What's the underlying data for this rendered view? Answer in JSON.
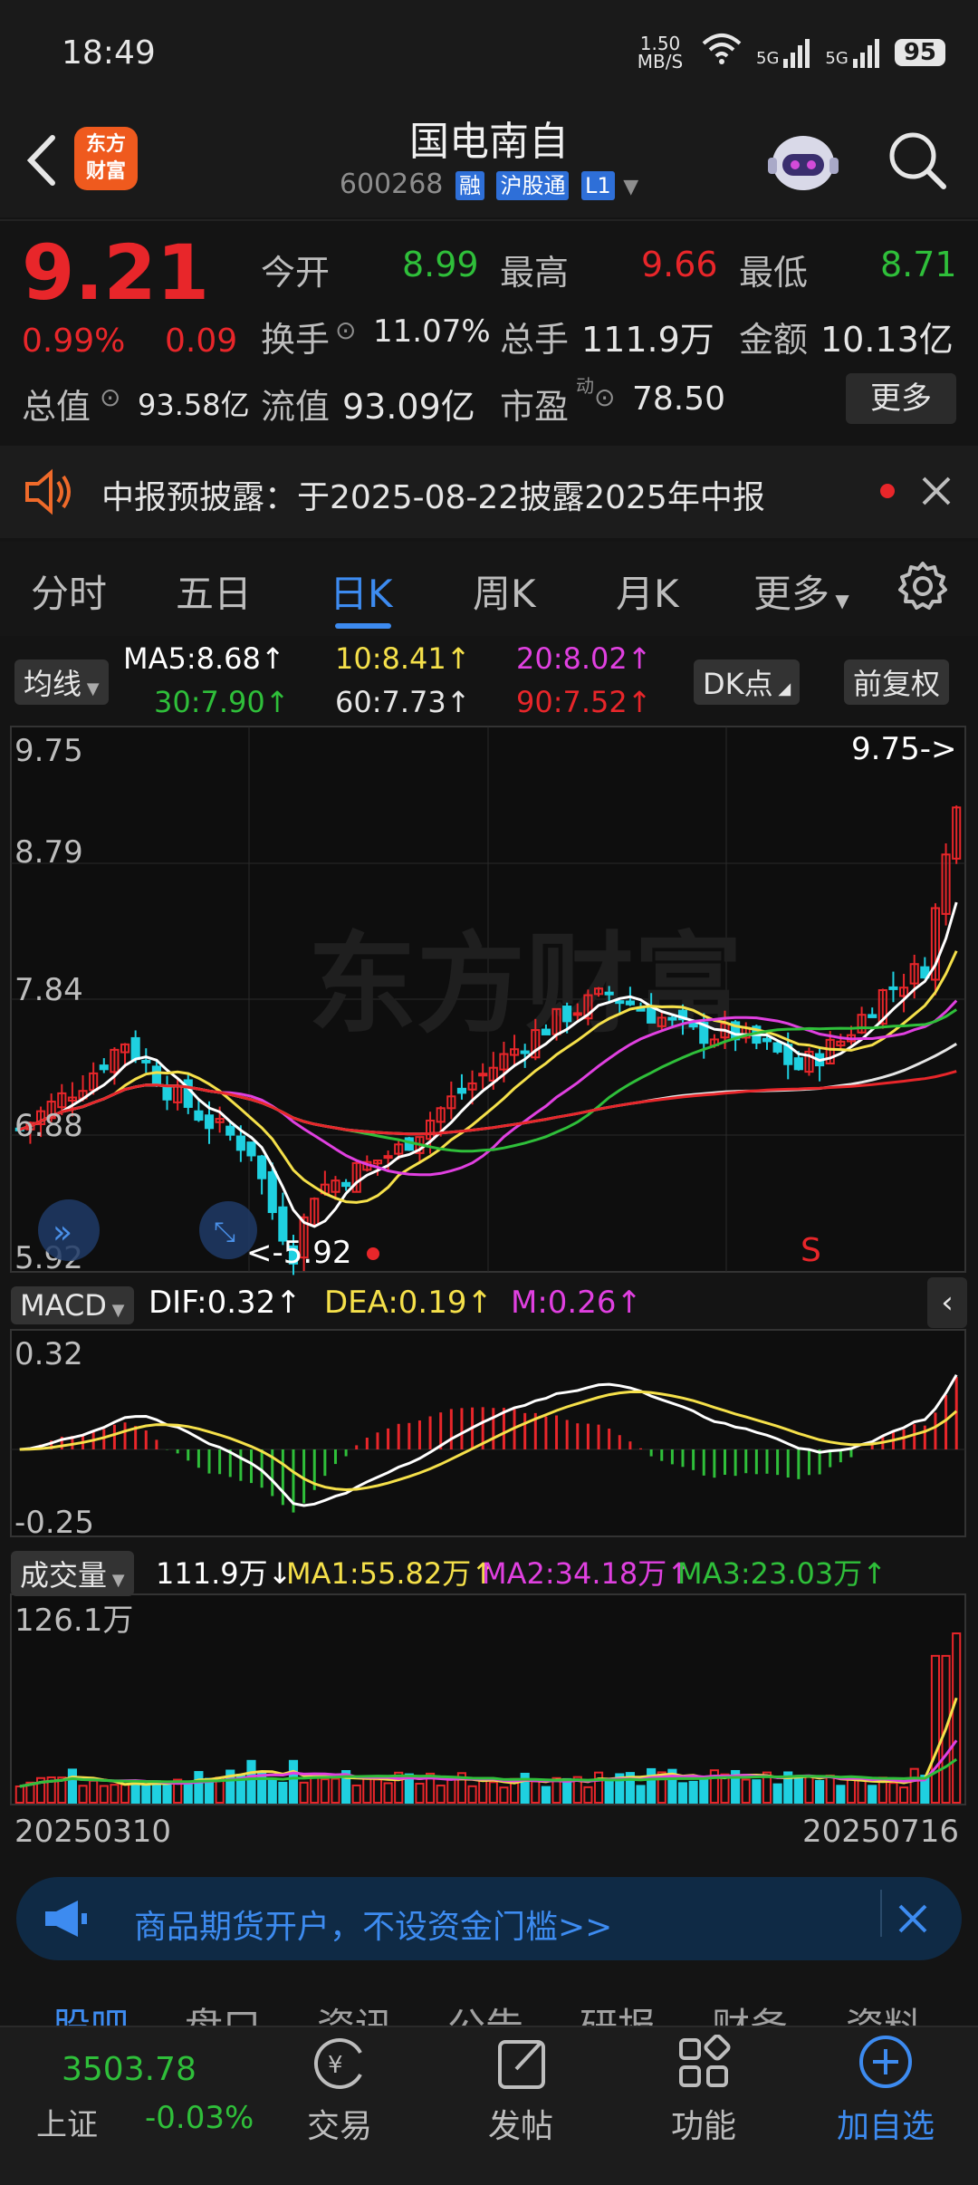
{
  "status_bar": {
    "time": "18:49",
    "net_speed": "1.50 MB/S",
    "signal1": "5G",
    "signal2": "5G",
    "battery": "95"
  },
  "header": {
    "logo_line1": "东方",
    "logo_line2": "财富",
    "stock_name": "国电南自",
    "stock_code": "600268",
    "tags": [
      "融",
      "沪股通",
      "L1"
    ]
  },
  "quote": {
    "price": "9.21",
    "pct": "0.99%",
    "change": "0.09",
    "open_label": "今开",
    "open": "8.99",
    "high_label": "最高",
    "high": "9.66",
    "low_label": "最低",
    "low": "8.71",
    "turnover_label": "换手",
    "turnover": "11.07%",
    "volume_label": "总手",
    "volume": "111.9万",
    "amount_label": "金额",
    "amount": "10.13亿",
    "mktcap_label": "总值",
    "mktcap": "93.58亿",
    "float_label": "流值",
    "float": "93.09亿",
    "pe_label": "市盈",
    "pe_sup": "动",
    "pe": "78.50",
    "more_label": "更多"
  },
  "notice": {
    "text": "中报预披露：于2025-08-22披露2025年中报"
  },
  "period_tabs": {
    "t1": "分时",
    "t2": "五日",
    "t3": "日K",
    "t4": "周K",
    "t5": "月K",
    "t6": "更多"
  },
  "ma_row": {
    "button": "均线",
    "ma5": "MA5:8.68↑",
    "ma10": "10:8.41↑",
    "ma20": "20:8.02↑",
    "ma30": "30:7.90↑",
    "ma60": "60:7.73↑",
    "ma90": "90:7.52↑",
    "dk_button": "DK点",
    "fq_button": "前复权"
  },
  "kline": {
    "y_labels": [
      "9.75",
      "8.79",
      "7.84",
      "6.88",
      "5.92"
    ],
    "max_marker": "9.75->",
    "min_marker": "<-5.92",
    "signal": "S"
  },
  "macd": {
    "button": "MACD",
    "dif": "DIF:0.32↑",
    "dea": "DEA:0.19↑",
    "m": "M:0.26↑",
    "y_top": "0.32",
    "y_bottom": "-0.25"
  },
  "volume": {
    "button": "成交量",
    "vol": "111.9万↓",
    "ma1": "MA1:55.82万↑",
    "ma2": "MA2:34.18万↑",
    "ma3": "MA3:23.03万↑",
    "y_top": "126.1万"
  },
  "dates": {
    "start": "20250310",
    "end": "20250716"
  },
  "ad": {
    "text": "商品期货开户，不设资金门槛>>"
  },
  "sub_tabs": [
    "股吧",
    "盘口",
    "资讯",
    "公告",
    "研报",
    "财务",
    "资料"
  ],
  "bottom_nav": {
    "index_value": "3503.78",
    "index_name": "上证",
    "index_change": "-0.03%",
    "trade": "交易",
    "post": "发帖",
    "func": "功能",
    "add": "加自选"
  },
  "colors": {
    "up": "#e8262a",
    "down": "#2fbf3a",
    "accent": "#3d8bf0",
    "ma5": "#ffffff",
    "ma10": "#f5e04a",
    "ma20": "#e040e0"
  }
}
